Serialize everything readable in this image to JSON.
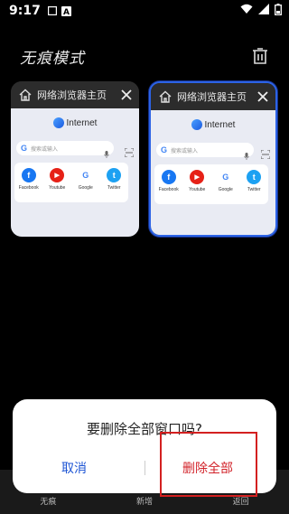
{
  "status_bar": {
    "time": "9:17"
  },
  "header": {
    "title": "无痕模式"
  },
  "tabs": [
    {
      "title": "网络浏览器主页",
      "logo_text": "Internet",
      "search_placeholder": "搜索或输入"
    },
    {
      "title": "网络浏览器主页",
      "logo_text": "Internet",
      "search_placeholder": "搜索或输入"
    }
  ],
  "shortcuts": [
    {
      "label": "Facebook",
      "letter": "f",
      "color": "#1877f2"
    },
    {
      "label": "Youtube",
      "letter": "▶",
      "color": "#e62117"
    },
    {
      "label": "Google",
      "letter": "G",
      "color": "#4285f4"
    },
    {
      "label": "Twitter",
      "letter": "t",
      "color": "#1da1f2"
    }
  ],
  "bottom_nav": {
    "items": [
      "无痕",
      "新增",
      "返回"
    ]
  },
  "dialog": {
    "message": "要删除全部窗口吗?",
    "cancel_label": "取消",
    "delete_label": "删除全部"
  },
  "colors": {
    "accent": "#2c63e6",
    "danger": "#d2232a",
    "cancel": "#1e55d4"
  }
}
